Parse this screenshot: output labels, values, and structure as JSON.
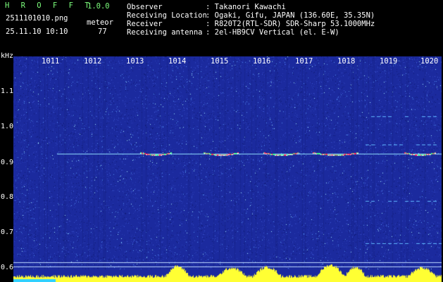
{
  "app": {
    "name": "H R O F F T",
    "version": "1.0.0"
  },
  "file": {
    "name": "2511101010.png",
    "datetime": "25.11.10 10:10"
  },
  "counter": {
    "label": "meteor",
    "value": "77"
  },
  "info": {
    "labels": [
      "Observer",
      "Receiving Location",
      "Receiver",
      "Receiving antenna"
    ],
    "values": [
      ": Takanori Kawachi",
      ": Ogaki, Gifu, JAPAN (136.60E, 35.35N)",
      ": R820T2(RTL-SDR) SDR-Sharp 53.1000MHz",
      ": 2el-HB9CV Vertical (el. E-W)"
    ]
  },
  "axis": {
    "y_unit": "kHz",
    "y_ticks": [
      "1.1",
      "1.0",
      "0.9",
      "0.8",
      "0.7",
      "0.6"
    ],
    "x_ticks": [
      "1011",
      "1012",
      "1013",
      "1014",
      "1015",
      "1016",
      "1017",
      "1018",
      "1019",
      "1020"
    ]
  },
  "colors": {
    "background": "#000000",
    "spectrum": "#1b2a9e",
    "header_green": "#7dff7d",
    "signal": "#ff2a5a"
  }
}
